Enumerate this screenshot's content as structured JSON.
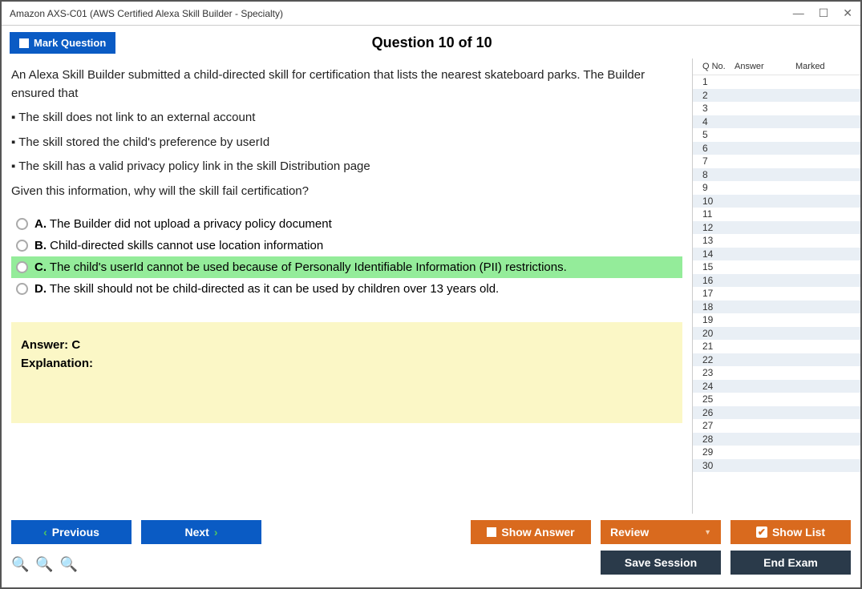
{
  "window": {
    "title": "Amazon AXS-C01 (AWS Certified Alexa Skill Builder - Specialty)"
  },
  "header": {
    "mark_label": "Mark Question",
    "question_title": "Question 10 of 10"
  },
  "question": {
    "intro1": "An Alexa Skill Builder submitted a child-directed skill for certification that lists the nearest skateboard parks. The Builder ensured that",
    "bullet1": "▪ The skill does not link to an external account",
    "bullet2": "▪ The skill stored the child's preference by userId",
    "bullet3": "▪ The skill has a valid privacy policy link in the skill Distribution page",
    "prompt": "Given this information, why will the skill fail certification?"
  },
  "options": {
    "a_label": "A.",
    "a_text": "The Builder did not upload a privacy policy document",
    "b_label": "B.",
    "b_text": "Child-directed skills cannot use location information",
    "c_label": "C.",
    "c_text": "The child's userId cannot be used because of Personally Identifiable Information (PII) restrictions.",
    "d_label": "D.",
    "d_text": "The skill should not be child-directed as it can be used by children over 13 years old."
  },
  "answer": {
    "line1": "Answer: C",
    "line2": "Explanation:"
  },
  "sidepanel": {
    "h1": "Q No.",
    "h2": "Answer",
    "h3": "Marked",
    "rows": [
      1,
      2,
      3,
      4,
      5,
      6,
      7,
      8,
      9,
      10,
      11,
      12,
      13,
      14,
      15,
      16,
      17,
      18,
      19,
      20,
      21,
      22,
      23,
      24,
      25,
      26,
      27,
      28,
      29,
      30
    ]
  },
  "footer": {
    "prev": "Previous",
    "next": "Next",
    "show_answer": "Show Answer",
    "review": "Review",
    "show_list": "Show List",
    "save_session": "Save Session",
    "end_exam": "End Exam"
  }
}
